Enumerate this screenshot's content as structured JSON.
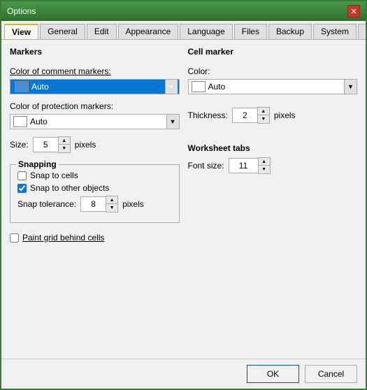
{
  "window": {
    "title": "Options",
    "close_label": "✕"
  },
  "tabs": [
    {
      "label": "View",
      "active": true
    },
    {
      "label": "General",
      "active": false
    },
    {
      "label": "Edit",
      "active": false
    },
    {
      "label": "Appearance",
      "active": false
    },
    {
      "label": "Language",
      "active": false
    },
    {
      "label": "Files",
      "active": false
    },
    {
      "label": "Backup",
      "active": false
    },
    {
      "label": "System",
      "active": false
    },
    {
      "label": "Fon ▶",
      "active": false
    }
  ],
  "left": {
    "section_label": "Markers",
    "comment_color_label": "Color of comment markers:",
    "comment_color_value": "Auto",
    "protection_color_label": "Color of protection markers:",
    "protection_color_value": "Auto",
    "size_label": "Size:",
    "size_value": "5",
    "size_unit": "pixels",
    "snapping": {
      "title": "Snapping",
      "snap_cells_label": "Snap to cells",
      "snap_cells_checked": false,
      "snap_objects_label": "Snap to other objects",
      "snap_objects_checked": true,
      "tolerance_label": "Snap tolerance:",
      "tolerance_value": "8",
      "tolerance_unit": "pixels"
    },
    "paint_grid_label": "Paint grid behind cells",
    "paint_grid_checked": false
  },
  "right": {
    "cell_marker_title": "Cell marker",
    "color_label": "Color:",
    "color_value": "Auto",
    "thickness_label": "Thickness:",
    "thickness_value": "2",
    "thickness_unit": "pixels",
    "worksheet_tabs_title": "Worksheet tabs",
    "font_size_label": "Font size:",
    "font_size_value": "11"
  },
  "footer": {
    "ok_label": "OK",
    "cancel_label": "Cancel"
  }
}
